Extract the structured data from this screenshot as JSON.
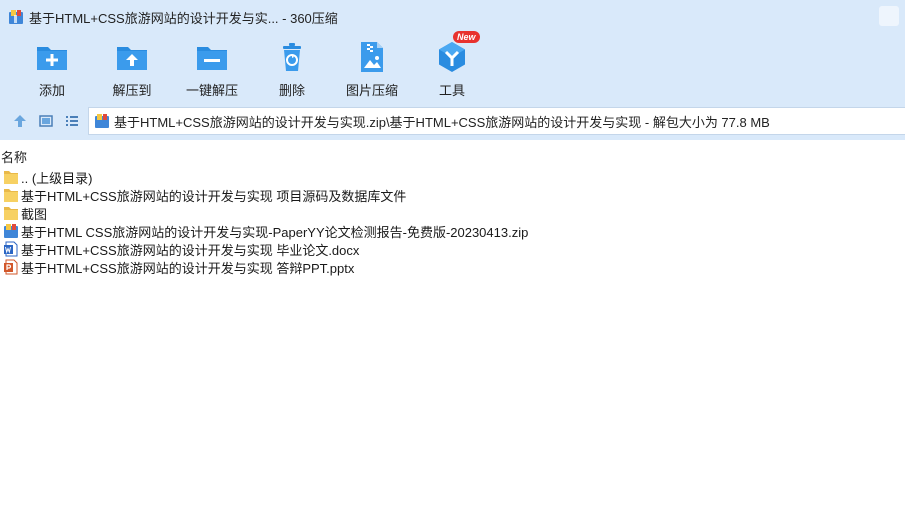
{
  "window": {
    "title": "基于HTML+CSS旅游网站的设计开发与实... - 360压缩"
  },
  "toolbar": {
    "items": [
      {
        "label": "添加",
        "icon": "add-icon"
      },
      {
        "label": "解压到",
        "icon": "extract-to-icon"
      },
      {
        "label": "一键解压",
        "icon": "one-click-extract-icon"
      },
      {
        "label": "删除",
        "icon": "delete-icon"
      },
      {
        "label": "图片压缩",
        "icon": "image-compress-icon"
      },
      {
        "label": "工具",
        "icon": "tools-icon",
        "badge": "New"
      }
    ]
  },
  "nav": {
    "path": "基于HTML+CSS旅游网站的设计开发与实现.zip\\基于HTML+CSS旅游网站的设计开发与实现 - 解包大小为 77.8 MB"
  },
  "list": {
    "column_name": "名称",
    "rows": [
      {
        "name": ".. (上级目录)",
        "type": "folder"
      },
      {
        "name": "基于HTML+CSS旅游网站的设计开发与实现 项目源码及数据库文件",
        "type": "folder"
      },
      {
        "name": "截图",
        "type": "folder"
      },
      {
        "name": "基于HTML CSS旅游网站的设计开发与实现-PaperYY论文检测报告-免费版-20230413.zip",
        "type": "zip"
      },
      {
        "name": "基于HTML+CSS旅游网站的设计开发与实现 毕业论文.docx",
        "type": "docx"
      },
      {
        "name": "基于HTML+CSS旅游网站的设计开发与实现 答辩PPT.pptx",
        "type": "pptx"
      }
    ]
  },
  "colors": {
    "toolbar_bg": "#d9e9fa",
    "icon_blue": "#2a8ce0",
    "badge_red": "#e8322e",
    "folder_yellow": "#f7d163"
  }
}
